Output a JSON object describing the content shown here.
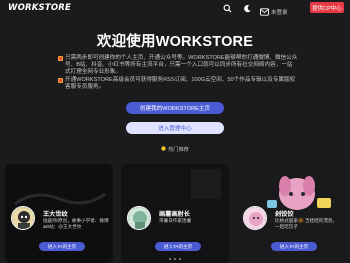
{
  "header": {
    "logo": "WORKSTORE",
    "user_label": "未登录",
    "sponsor_button": "提供CP中心"
  },
  "hero": {
    "title": "欢迎使用WORKSTORE"
  },
  "intro": {
    "paragraphs": [
      "只需两步即可创建你的个人主页、开通公众号等。WORKSTORE能够帮你打通微博、微信公众号、B站、抖音、小红书等所有主流平台，只需一个入口就可以同步所有社交网络内容，一站式打理全网专业形象。",
      "开通WORKSTORE高级会员可获得服务RSS订阅、100G云空间、50个作品专辑以及专属版权客服专员服务。"
    ]
  },
  "buttons": {
    "create_homepage": "创建我的WORKSTORE主页",
    "enter_admin": "进入管理中心"
  },
  "section": {
    "label": "热门推荐"
  },
  "cards": [
    {
      "name": "王大世纹",
      "desc": "插画师/原创，故事小学者、微博&B站：@王大世纹",
      "button": "进入TA的主页"
    },
    {
      "name": "画薯画射长",
      "desc": "带薯日作家连薯",
      "button": "进入TA的主页"
    },
    {
      "name": "剁饺饺",
      "desc": "比格式画家🔆 吉娃娃的漂亮，一起吃饺子",
      "button": "进入TA的主页"
    }
  ],
  "colors": {
    "accent": "#4a5bd4",
    "sponsor": "#e63946",
    "background": "#1b1b1d"
  }
}
